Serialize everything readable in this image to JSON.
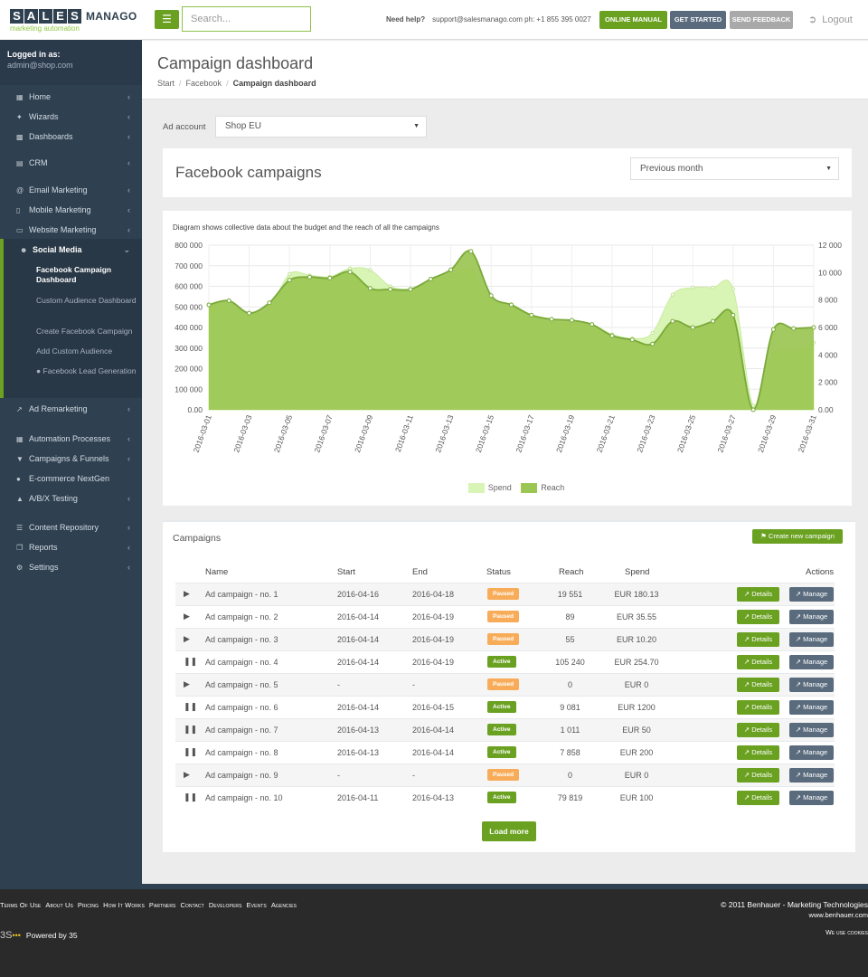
{
  "brand": {
    "letters": [
      "S",
      "A",
      "L",
      "E",
      "S"
    ],
    "word": "MANAGO",
    "tagline": "marketing automation"
  },
  "topbar": {
    "menu_icon": "hamburger-icon",
    "search_placeholder": "Search...",
    "help_label": "Need help?",
    "help_contact": "support@salesmanago.com ph: +1 855 395 0027",
    "online_manual": "ONLINE MANUAL",
    "get_started": "GET STARTED",
    "send_feedback": "SEND FEEDBACK",
    "logout": "Logout"
  },
  "sidebar": {
    "logged_label": "Logged in as:",
    "user_email": "admin@shop.com",
    "items": [
      {
        "label": "Home",
        "icon": "grid-icon"
      },
      {
        "label": "Wizards",
        "icon": "wand-icon"
      },
      {
        "label": "Dashboards",
        "icon": "bar-chart-icon"
      },
      {
        "label": "CRM",
        "icon": "chart-icon"
      },
      {
        "label": "Email Marketing",
        "icon": "at-icon"
      },
      {
        "label": "Mobile Marketing",
        "icon": "mobile-icon"
      },
      {
        "label": "Website Marketing",
        "icon": "laptop-icon"
      },
      {
        "label": "Social Media",
        "icon": "users-icon"
      },
      {
        "label": "Ad Remarketing",
        "icon": "line-chart-icon"
      },
      {
        "label": "Automation Processes",
        "icon": "grid-icon"
      },
      {
        "label": "Campaigns & Funnels",
        "icon": "filter-icon"
      },
      {
        "label": "E-commerce NextGen",
        "icon": "lock-icon"
      },
      {
        "label": "A/B/X Testing",
        "icon": "flask-icon"
      },
      {
        "label": "Content Repository",
        "icon": "database-icon"
      },
      {
        "label": "Reports",
        "icon": "copy-icon"
      },
      {
        "label": "Settings",
        "icon": "gears-icon"
      }
    ],
    "sub_items": [
      "Facebook Campaign Dashboard",
      "Custom Audience Dashboard",
      "Create Facebook Campaign",
      "Add Custom Audience",
      "Facebook Lead Generation"
    ]
  },
  "page": {
    "title": "Campaign dashboard",
    "breadcrumb": [
      "Start",
      "Facebook",
      "Campaign dashboard"
    ],
    "ad_account_label": "Ad account",
    "ad_account_value": "Shop EU",
    "fb_title": "Facebook campaigns",
    "period_value": "Previous month"
  },
  "chart_data": {
    "type": "area",
    "title": "Diagram shows collective data about the budget and the reach of all the campaigns",
    "x": [
      "2016-03-01",
      "2016-03-02",
      "2016-03-03",
      "2016-03-04",
      "2016-03-05",
      "2016-03-06",
      "2016-03-07",
      "2016-03-08",
      "2016-03-09",
      "2016-03-10",
      "2016-03-11",
      "2016-03-12",
      "2016-03-13",
      "2016-03-14",
      "2016-03-15",
      "2016-03-16",
      "2016-03-17",
      "2016-03-18",
      "2016-03-19",
      "2016-03-20",
      "2016-03-21",
      "2016-03-22",
      "2016-03-23",
      "2016-03-24",
      "2016-03-25",
      "2016-03-26",
      "2016-03-27",
      "2016-03-28",
      "2016-03-29",
      "2016-03-30",
      "2016-03-31"
    ],
    "x_tick_labels": [
      "2016-03-01",
      "2016-03-03",
      "2016-03-05",
      "2016-03-07",
      "2016-03-09",
      "2016-03-11",
      "2016-03-13",
      "2016-03-15",
      "2016-03-17",
      "2016-03-19",
      "2016-03-21",
      "2016-03-23",
      "2016-03-25",
      "2016-03-27",
      "2016-03-29",
      "2016-03-31"
    ],
    "y_left_ticks": [
      "800 000",
      "700 000",
      "600 000",
      "500 000",
      "400 000",
      "300 000",
      "200 000",
      "100 000",
      "0.00"
    ],
    "y_right_ticks": [
      "12 000",
      "10 000",
      "8 000",
      "6 000",
      "4 000",
      "2 000",
      "0.00"
    ],
    "ylim_left": [
      0,
      800000
    ],
    "ylim_right": [
      0,
      12000
    ],
    "series": [
      {
        "name": "Spend",
        "axis": "right",
        "color": "#d9f5b5",
        "values": [
          7600,
          7800,
          7000,
          7400,
          9900,
          9800,
          9700,
          10300,
          10200,
          9000,
          8800,
          9300,
          9800,
          10200,
          8000,
          7700,
          6900,
          6400,
          6300,
          6200,
          5500,
          5200,
          5600,
          8400,
          8900,
          8900,
          8800,
          300,
          4100,
          4300,
          4900
        ]
      },
      {
        "name": "Reach",
        "axis": "left",
        "color": "#9bc653",
        "line_color": "#7aa93a",
        "values": [
          510000,
          530000,
          470000,
          520000,
          630000,
          645000,
          640000,
          670000,
          590000,
          585000,
          585000,
          635000,
          680000,
          770000,
          555000,
          510000,
          460000,
          440000,
          435000,
          415000,
          360000,
          340000,
          320000,
          430000,
          400000,
          430000,
          460000,
          0,
          390000,
          395000,
          400000
        ]
      }
    ],
    "grid": true,
    "legend_position": "bottom"
  },
  "campaigns": {
    "title": "Campaigns",
    "create_button": "Create new campaign",
    "columns": [
      "Name",
      "Start",
      "End",
      "Status",
      "Reach",
      "Spend",
      "Actions"
    ],
    "details_label": "Details",
    "manage_label": "Manage",
    "load_more": "Load more",
    "rows": [
      {
        "icon": "play-icon",
        "name": "Ad campaign - no. 1",
        "start": "2016-04-16",
        "end": "2016-04-18",
        "status": "Paused",
        "reach": "19 551",
        "spend": "EUR 180.13"
      },
      {
        "icon": "play-icon",
        "name": "Ad campaign - no. 2",
        "start": "2016-04-14",
        "end": "2016-04-19",
        "status": "Paused",
        "reach": "89",
        "spend": "EUR 35.55"
      },
      {
        "icon": "play-icon",
        "name": "Ad campaign - no. 3",
        "start": "2016-04-14",
        "end": "2016-04-19",
        "status": "Paused",
        "reach": "55",
        "spend": "EUR 10.20"
      },
      {
        "icon": "pause-icon",
        "name": "Ad campaign - no. 4",
        "start": "2016-04-14",
        "end": "2016-04-19",
        "status": "Active",
        "reach": "105 240",
        "spend": "EUR 254.70"
      },
      {
        "icon": "play-icon",
        "name": "Ad campaign - no. 5",
        "start": "-",
        "end": "-",
        "status": "Paused",
        "reach": "0",
        "spend": "EUR 0"
      },
      {
        "icon": "pause-icon",
        "name": "Ad campaign - no. 6",
        "start": "2016-04-14",
        "end": "2016-04-15",
        "status": "Active",
        "reach": "9 081",
        "spend": "EUR 1200"
      },
      {
        "icon": "pause-icon",
        "name": "Ad campaign - no. 7",
        "start": "2016-04-13",
        "end": "2016-04-14",
        "status": "Active",
        "reach": "1 011",
        "spend": "EUR 50"
      },
      {
        "icon": "pause-icon",
        "name": "Ad campaign - no. 8",
        "start": "2016-04-13",
        "end": "2016-04-14",
        "status": "Active",
        "reach": "7 858",
        "spend": "EUR 200"
      },
      {
        "icon": "play-icon",
        "name": "Ad campaign - no. 9",
        "start": "-",
        "end": "-",
        "status": "Paused",
        "reach": "0",
        "spend": "EUR 0"
      },
      {
        "icon": "pause-icon",
        "name": "Ad campaign - no. 10",
        "start": "2016-04-11",
        "end": "2016-04-13",
        "status": "Active",
        "reach": "79 819",
        "spend": "EUR 100"
      }
    ]
  },
  "footer": {
    "links": [
      "Terms Of Use",
      "About Us",
      "Pricing",
      "How It Works",
      "Partners",
      "Contact",
      "Developers",
      "Events",
      "Agencies"
    ],
    "copyright": "© 2011 Benhauer - Marketing Technologies",
    "url": "www.benhauer.com",
    "powered": "Powered by 35",
    "cookies": "We use cookies"
  },
  "colors": {
    "accent": "#6aa121",
    "sidebar": "#2f4050",
    "paused": "#f8ac59",
    "manage": "#596b7d"
  }
}
